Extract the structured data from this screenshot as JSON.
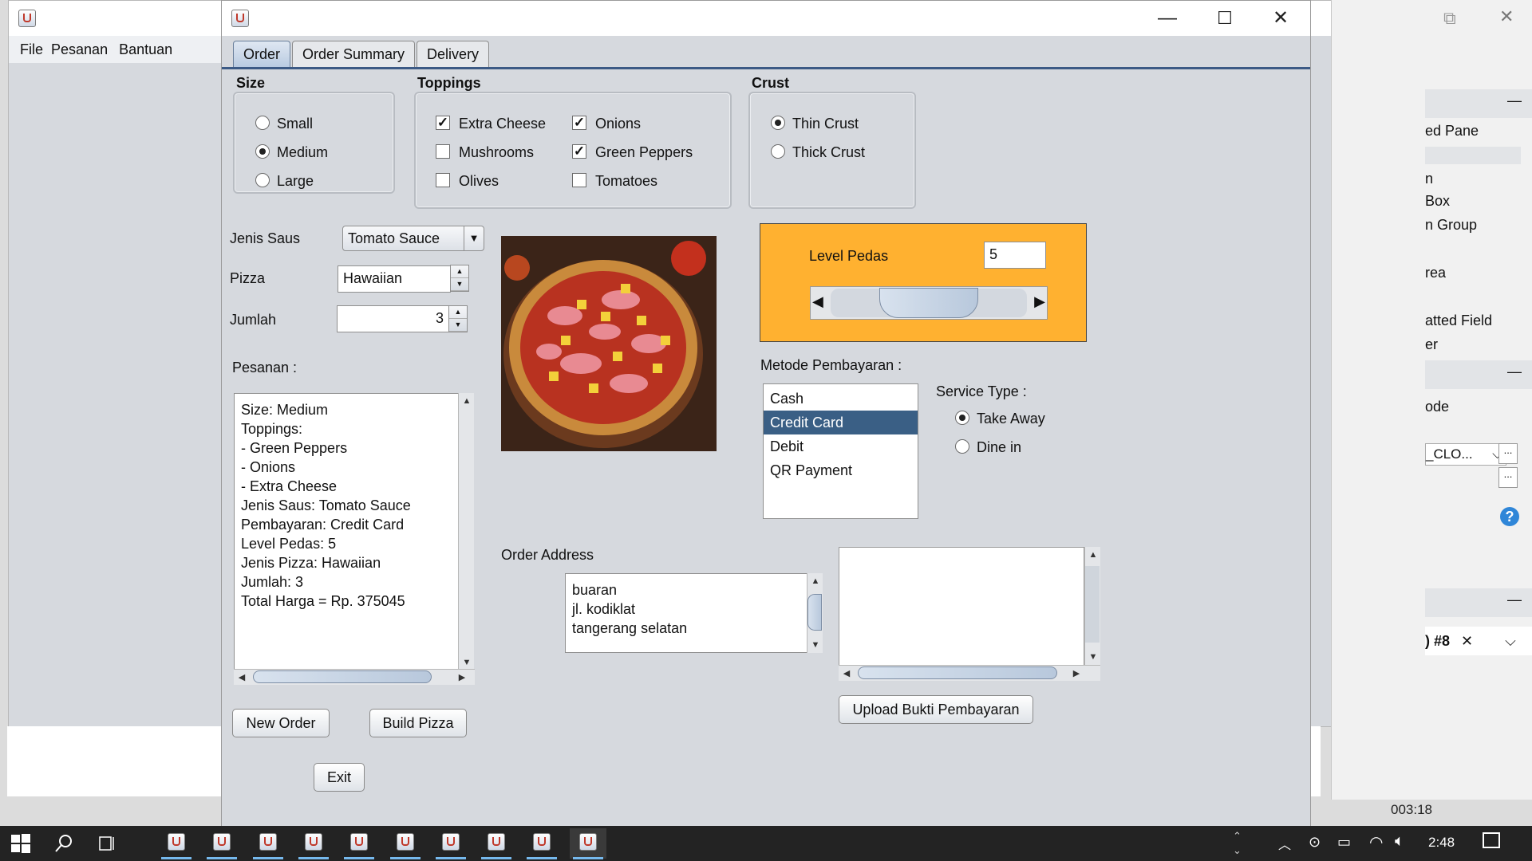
{
  "background_window": {
    "menu": [
      "File",
      "Pesanan",
      "Bantuan"
    ]
  },
  "right_window": {
    "items": [
      "ed Pane",
      "n",
      "Box",
      "n Group",
      "rea",
      "atted Field",
      "er",
      "ode",
      "_CLO...",
      ") #8"
    ],
    "status_time": "003:18"
  },
  "main_window": {
    "tabs": [
      "Order",
      "Order Summary",
      "Delivery"
    ],
    "size": {
      "title": "Size",
      "options": [
        {
          "label": "Small",
          "selected": false
        },
        {
          "label": "Medium",
          "selected": true
        },
        {
          "label": "Large",
          "selected": false
        }
      ]
    },
    "toppings": {
      "title": "Toppings",
      "options": [
        {
          "label": "Extra Cheese",
          "checked": true
        },
        {
          "label": "Mushrooms",
          "checked": false
        },
        {
          "label": "Olives",
          "checked": false
        },
        {
          "label": "Onions",
          "checked": true
        },
        {
          "label": "Green Peppers",
          "checked": true
        },
        {
          "label": "Tomatoes",
          "checked": false
        }
      ]
    },
    "crust": {
      "title": "Crust",
      "options": [
        {
          "label": "Thin Crust",
          "selected": true
        },
        {
          "label": "Thick Crust",
          "selected": false
        }
      ]
    },
    "form": {
      "sauce_label": "Jenis Saus",
      "sauce_value": "Tomato Sauce",
      "pizza_label": "Pizza",
      "pizza_value": "Hawaiian",
      "qty_label": "Jumlah",
      "qty_value": "3",
      "pesanan_label": "Pesanan :"
    },
    "pesanan_lines": [
      "Size: Medium",
      "Toppings:",
      "- Green Peppers",
      "- Onions",
      "- Extra Cheese",
      "Jenis Saus: Tomato Sauce",
      "Pembayaran: Credit Card",
      "Level Pedas: 5",
      "Jenis Pizza: Hawaiian",
      "Jumlah: 3",
      "Total Harga = Rp. 375045"
    ],
    "spicy": {
      "label": "Level Pedas",
      "value": "5",
      "panel_color": "#ffb130"
    },
    "payment": {
      "label": "Metode Pembayaran :",
      "options": [
        "Cash",
        "Credit Card",
        "Debit",
        "QR Payment"
      ],
      "selected": "Credit Card"
    },
    "service": {
      "label": "Service Type :",
      "options": [
        {
          "label": "Take Away",
          "selected": true
        },
        {
          "label": "Dine in",
          "selected": false
        }
      ]
    },
    "address": {
      "label": "Order Address",
      "lines": [
        "buaran",
        "jl. kodiklat",
        "tangerang selatan"
      ]
    },
    "buttons": {
      "new_order": "New Order",
      "build_pizza": "Build Pizza",
      "exit": "Exit",
      "upload": "Upload Bukti Pembayaran"
    }
  },
  "taskbar": {
    "clock": "2:48"
  }
}
